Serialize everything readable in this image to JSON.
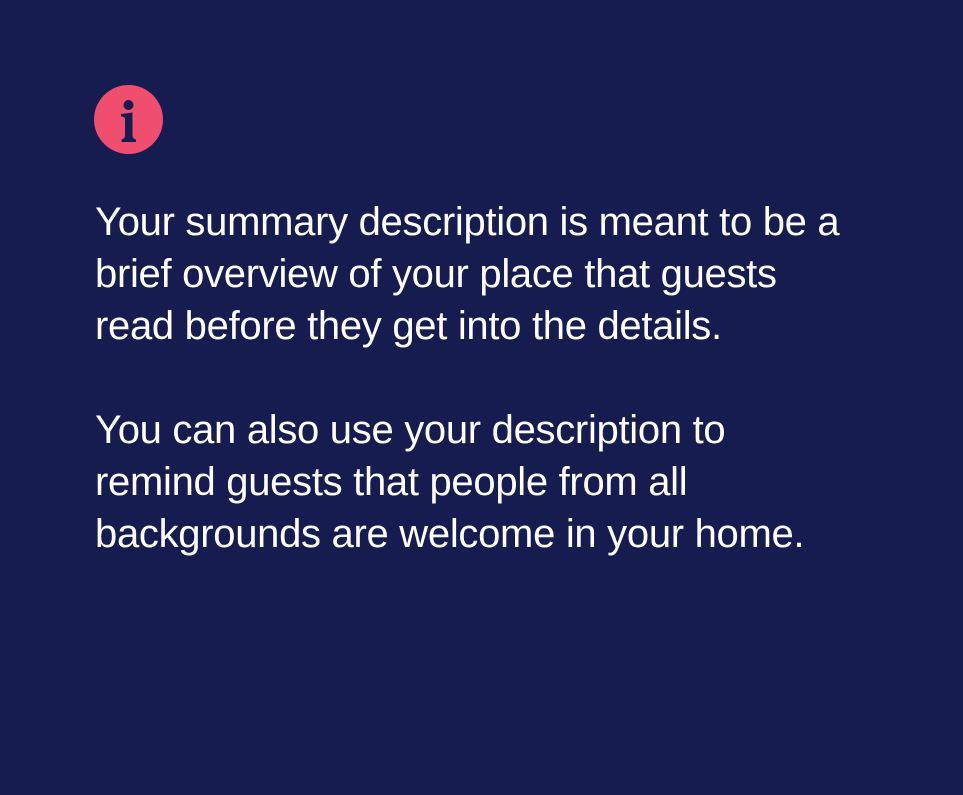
{
  "tip": {
    "icon": "info-icon",
    "icon_color": "#f04e6f",
    "background_color": "#171c50",
    "text_color": "#ffffff",
    "paragraphs": [
      "Your summary description is meant to be a brief overview of your place that guests read before they get into the details.",
      "You can also use your description to remind guests that people from all backgrounds are welcome in your home."
    ]
  }
}
